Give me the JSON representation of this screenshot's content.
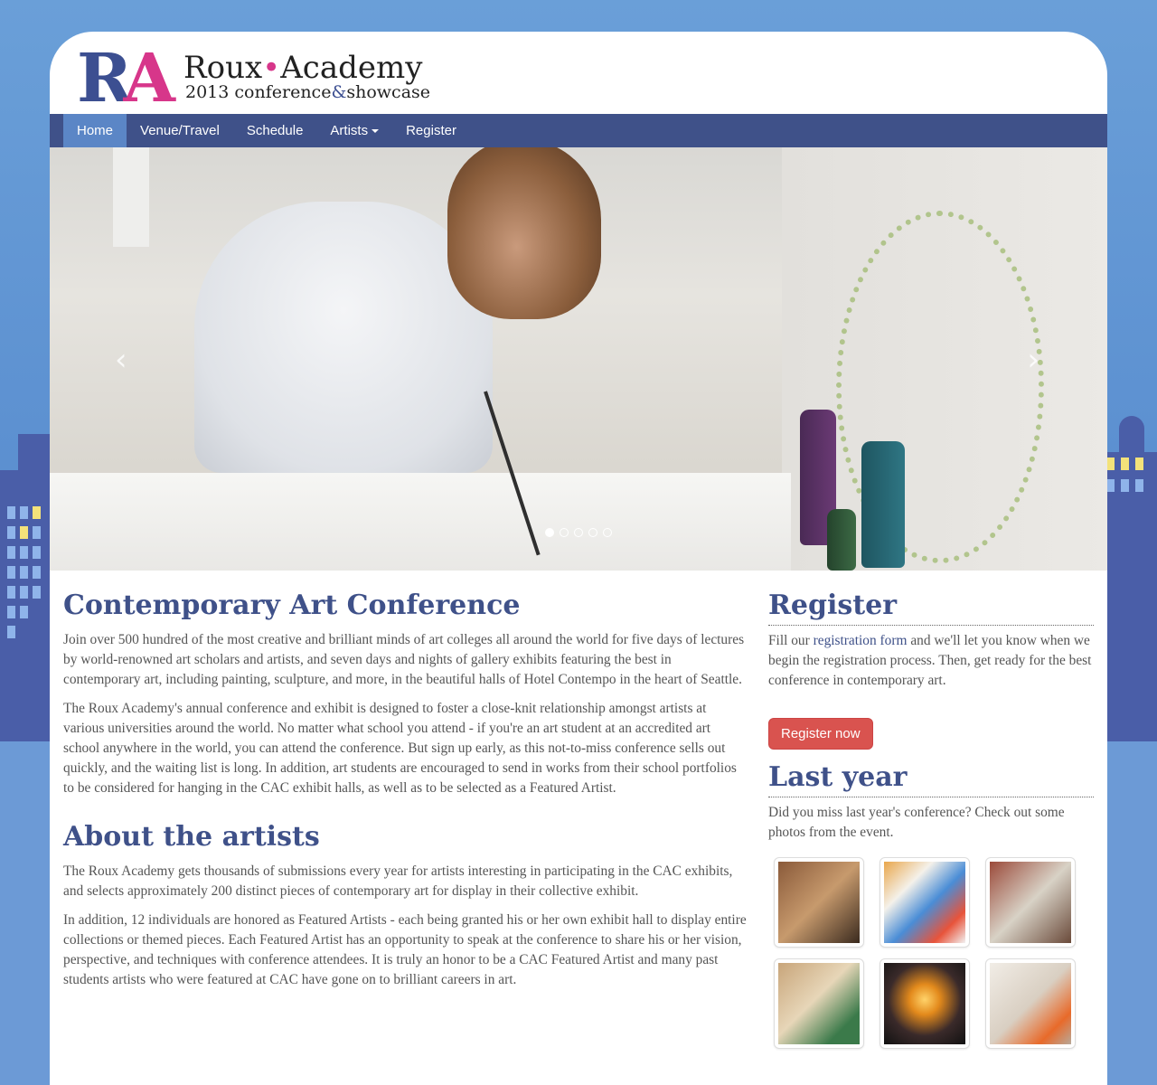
{
  "logo": {
    "r": "R",
    "a": "A",
    "name_left": "Roux",
    "name_dot": "•",
    "name_right": "Academy",
    "sub_year": "2013 conference",
    "sub_amp": "&",
    "sub_rest": "showcase"
  },
  "nav": {
    "items": [
      {
        "label": "Home",
        "active": true
      },
      {
        "label": "Venue/Travel"
      },
      {
        "label": "Schedule"
      },
      {
        "label": "Artists",
        "dropdown": true
      },
      {
        "label": "Register"
      }
    ]
  },
  "carousel": {
    "prev_icon": "chevron-left-icon",
    "next_icon": "chevron-right-icon",
    "prev_glyph": "‹",
    "next_glyph": "›",
    "indicators": 5,
    "active_index": 0
  },
  "main": {
    "title": "Contemporary Art Conference",
    "p1": "Join over 500 hundred of the most creative and brilliant minds of art colleges all around the world for five days of lectures by world-renowned art scholars and artists, and seven days and nights of gallery exhibits featuring the best in contemporary art, including painting, sculpture, and more, in the beautiful halls of Hotel Contempo in the heart of Seattle.",
    "p2": "The Roux Academy's annual conference and exhibit is designed to foster a close-knit relationship amongst artists at various universities around the world. No matter what school you attend - if you're an art student at an accredited art school anywhere in the world, you can attend the conference. But sign up early, as this not-to-miss conference sells out quickly, and the waiting list is long. In addition, art students are encouraged to send in works from their school portfolios to be considered for hanging in the CAC exhibit halls, as well as to be selected as a Featured Artist.",
    "about_title": "About the artists",
    "p3": "The Roux Academy gets thousands of submissions every year for artists interesting in participating in the CAC exhibits, and selects approximately 200 distinct pieces of contemporary art for display in their collective exhibit.",
    "p4": "In addition, 12 individuals are honored as Featured Artists - each being granted his or her own exhibit hall to display entire collections or themed pieces. Each Featured Artist has an opportunity to speak at the conference to share his or her vision, perspective, and techniques with conference attendees. It is truly an honor to be a CAC Featured Artist and many past students artists who were featured at CAC have gone on to brilliant careers in art."
  },
  "side": {
    "register_title": "Register",
    "reg_pre": "Fill our ",
    "reg_link": "registration form",
    "reg_post": " and we'll let you know when we begin the registration process. Then, get ready for the best conference in contemporary art.",
    "register_button": "Register now",
    "last_title": "Last year",
    "last_text": "Did you miss last year's conference? Check out some photos from the event."
  },
  "colors": {
    "brand_blue": "#3f5189",
    "brand_pink": "#d7368a",
    "nav_active": "#5b86c6",
    "button_red": "#d9534f"
  }
}
